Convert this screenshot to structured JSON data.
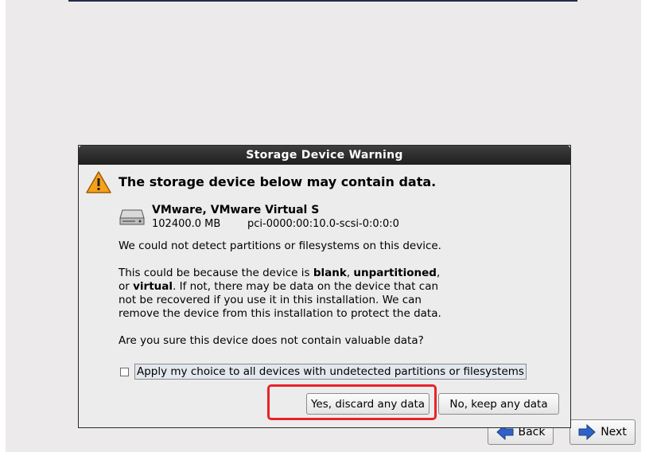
{
  "dialog": {
    "title": "Storage Device Warning",
    "headline": "The storage device below may contain data.",
    "device": {
      "name": "VMware, VMware Virtual S",
      "size": "102400.0 MB",
      "path": "pci-0000:00:10.0-scsi-0:0:0:0"
    },
    "paragraph1": "We could not detect partitions or filesystems on this device.",
    "paragraph2": {
      "p1": "This could be because the device is ",
      "b1": "blank",
      "p2": ", ",
      "b2": "unpartitioned",
      "p3": ",",
      "p4": "or ",
      "b3": "virtual",
      "p5": ". If not, there may be data on the device that can",
      "line3": "not be recovered if you use it in this installation. We can",
      "line4": "remove the device from this installation to protect the data."
    },
    "question": "Are you sure this device does not contain valuable data?",
    "checkbox_label": "Apply my choice to all devices with undetected partitions or filesystems",
    "checkbox_checked": false,
    "yes_button": "Yes, discard any data",
    "no_button": "No, keep any data"
  },
  "nav": {
    "back_label": "Back",
    "next_label": "Next"
  },
  "icons": {
    "warning": "warning-icon",
    "disk": "hard-disk-icon",
    "back": "back-arrow-icon",
    "next": "next-arrow-icon"
  },
  "colors": {
    "highlight": "#e8232a",
    "titlebar": "#2a2a2a",
    "warning_fill": "#f5a21b",
    "arrow_blue": "#2f62c8"
  }
}
